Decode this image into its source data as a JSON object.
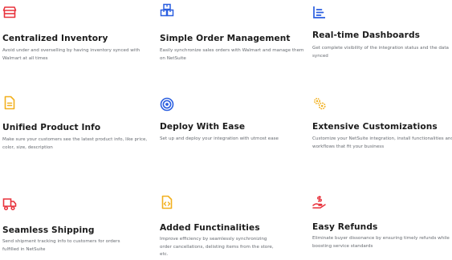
{
  "colors": {
    "red": "#e8323c",
    "blue": "#2b5fe0",
    "yellow": "#f2b01e",
    "title": "#1b1b1b",
    "text": "#666a70"
  },
  "features": [
    {
      "icon": "storefront-icon",
      "title": "Centralized Inventory",
      "desc": "Avoid under and overselling by having inventory synced with Walmart at all times"
    },
    {
      "icon": "packages-icon",
      "title": "Simple Order Management",
      "desc": "Easily synchronize sales orders with Walmart and manage them on NetSuite"
    },
    {
      "icon": "dashboard-chart-icon",
      "title": "Real-time Dashboards",
      "desc": "Get complete visibility of the integration status and the data synced"
    },
    {
      "icon": "document-icon",
      "title": "Unified Product Info",
      "desc": "Make sure your customers see the latest product info, like price, color, size, description"
    },
    {
      "icon": "target-icon",
      "title": "Deploy With Ease",
      "desc": "Set up and deploy your integration with utmost ease"
    },
    {
      "icon": "gears-icon",
      "title": "Extensive Customizations",
      "desc": "Customize your NetSuite integration, install functionalities and workflows that fit your business"
    },
    {
      "icon": "shipping-truck-icon",
      "title": "Seamless Shipping",
      "desc": "Send shipment tracking info to customers for orders fulfilled in NetSuite"
    },
    {
      "icon": "code-file-icon",
      "title": "Added Functinalities",
      "desc": "Improve efficiency by seamlessly synchronizing order cancellations, delisting items from the store, etc."
    },
    {
      "icon": "refund-hand-icon",
      "title": "Easy Refunds",
      "desc": "Eliminate buyer dissonance by ensuring timely refunds while boosting service standards"
    }
  ]
}
